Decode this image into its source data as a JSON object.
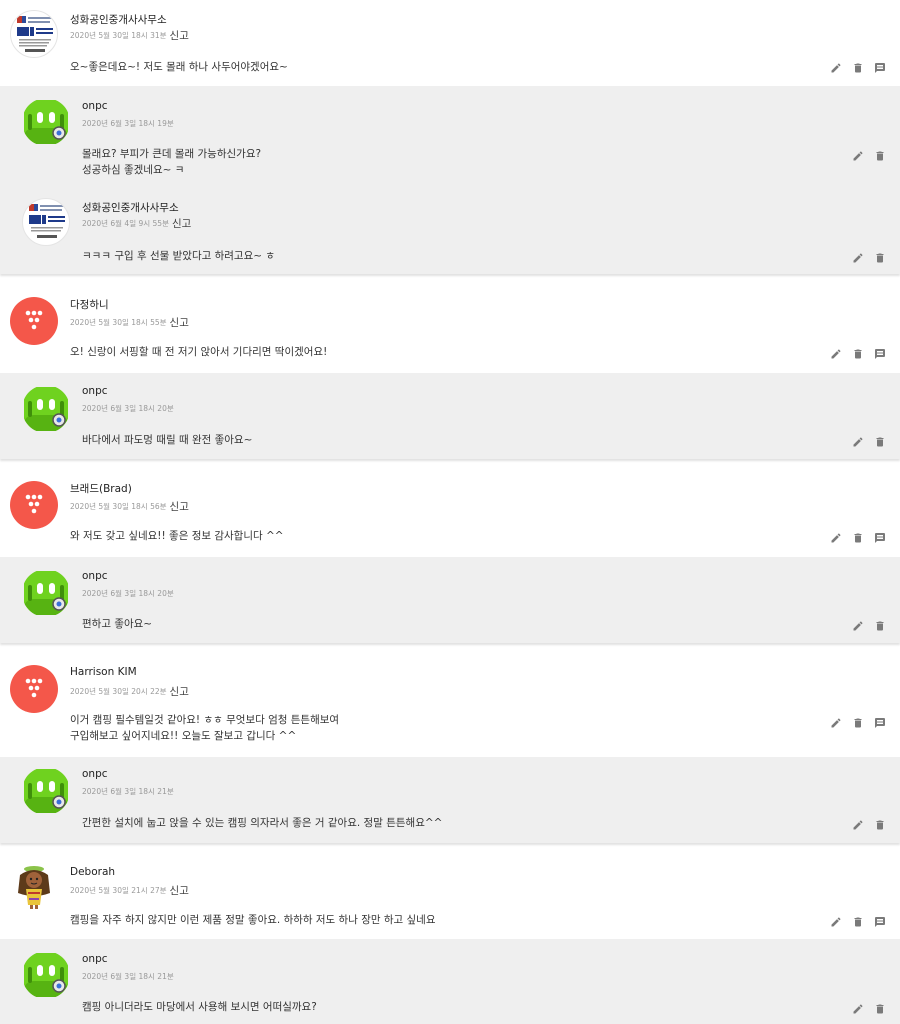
{
  "report_label": "신고",
  "icons": {
    "edit": "pencil-icon",
    "delete": "trash-icon",
    "reply": "comment-icon"
  },
  "colors": {
    "reply_bg": "#efefef",
    "avatar_red": "#f4574a",
    "avatar_green": "#6fd21f"
  },
  "threads": [
    {
      "comment": {
        "author": "성화공인중개사사무소",
        "date": "2020년 5월 30일 18시 31분",
        "text": "오~좋은데요~! 저도 몰래 하나 사두어야겠어요~"
      },
      "replies": [
        {
          "author": "onpc",
          "date": "2020년 6월 3일 18시 19분",
          "text": "몰래요? 부피가 큰데 몰래 가능하신가요?\n성공하심 좋겠네요~ ㅋ"
        },
        {
          "author": "성화공인중개사사무소",
          "date": "2020년 6월 4일 9시 55분",
          "text": "ㅋㅋㅋ 구입 후 선물 받았다고 하려고요~ ㅎ"
        }
      ]
    },
    {
      "comment": {
        "author": "다정하니",
        "date": "2020년 5월 30일 18시 55분",
        "text": "오! 신랑이 서핑할 때 전 저기 앉아서 기다리면 딱이겠어요!"
      },
      "replies": [
        {
          "author": "onpc",
          "date": "2020년 6월 3일 18시 20분",
          "text": "바다에서 파도멍 때릴 때 완전 좋아요~"
        }
      ]
    },
    {
      "comment": {
        "author": "브래드(Brad)",
        "date": "2020년 5월 30일 18시 56분",
        "text": "와 저도 갖고 싶네요!! 좋은 정보 감사합니다 ^^"
      },
      "replies": [
        {
          "author": "onpc",
          "date": "2020년 6월 3일 18시 20분",
          "text": "편하고 좋아요~"
        }
      ]
    },
    {
      "comment": {
        "author": "Harrison KIM",
        "date": "2020년 5월 30일 20시 22분",
        "text": "이거 캠핑 필수템일것 같아요! ㅎㅎ 무엇보다 엄청 튼튼해보여\n구입해보고 싶어지네요!! 오늘도 잘보고 갑니다 ^^"
      },
      "replies": [
        {
          "author": "onpc",
          "date": "2020년 6월 3일 18시 21분",
          "text": "간편한 설치에 눕고 앉을 수 있는 캠핑 의자라서 좋은 거 같아요. 정말 튼튼해요^^"
        }
      ]
    },
    {
      "comment": {
        "author": "Deborah",
        "date": "2020년 5월 30일 21시 27분",
        "text": "캠핑을 자주 하지 않지만 이런 제품 정말 좋아요. 하하하 저도 하나 장만 하고 싶네요"
      },
      "replies": [
        {
          "author": "onpc",
          "date": "2020년 6월 3일 18시 21분",
          "text": "캠핑 아니더라도 마당에서 사용해 보시면 어떠실까요?"
        }
      ]
    }
  ]
}
